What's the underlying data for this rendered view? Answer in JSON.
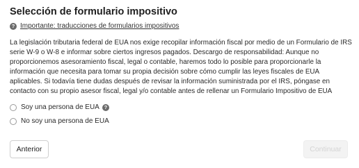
{
  "page": {
    "title": "Selección de formulario impositivo",
    "notice_icon": "question-circle-icon",
    "notice_link": "Importante: traducciones de formularios impositivos",
    "description": "La legislación tributaria federal de EUA nos exige recopilar información fiscal por medio de un Formulario de IRS serie W-9 o W-8 e informar sobre ciertos ingresos pagados. Descargo de responsabilidad: Aunque no proporcionemos asesoramiento fiscal, legal o contable, haremos todo lo posible para proporcionarle la información que necesita para tomar su propia decisión sobre cómo cumplir las leyes fiscales de EUA aplicables. Si todavía tiene dudas después de revisar la información suministrada por el IRS, póngase en contacto con su propio asesor fiscal, legal y/o contable antes de rellenar un Formulario Impositivo de EUA"
  },
  "options": [
    {
      "label": "Soy una persona de EUA",
      "selected": false,
      "has_help_icon": true
    },
    {
      "label": "No soy una persona de EUA",
      "selected": false,
      "has_help_icon": false
    }
  ],
  "buttons": {
    "back_label": "Anterior",
    "continue_label": "Continuar",
    "continue_disabled": true
  }
}
